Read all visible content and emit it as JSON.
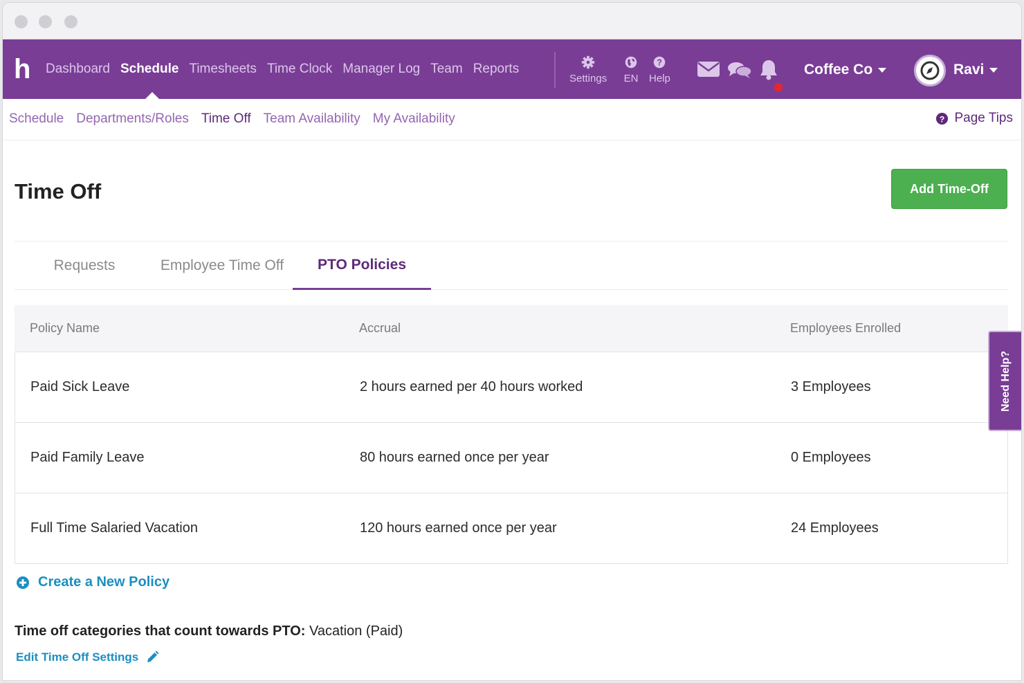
{
  "app": {
    "logo": "h",
    "nav": [
      {
        "label": "Dashboard",
        "active": false
      },
      {
        "label": "Schedule",
        "active": true
      },
      {
        "label": "Timesheets",
        "active": false
      },
      {
        "label": "Time Clock",
        "active": false
      },
      {
        "label": "Manager Log",
        "active": false
      },
      {
        "label": "Team",
        "active": false
      },
      {
        "label": "Reports",
        "active": false
      }
    ],
    "tools": {
      "settings": "Settings",
      "language": "EN",
      "help": "Help"
    },
    "icons": [
      "envelope-icon",
      "chat-bubbles-icon",
      "bell-icon"
    ],
    "company": "Coffee Co",
    "user": "Ravi"
  },
  "subnav": {
    "items": [
      {
        "label": "Schedule",
        "active": false
      },
      {
        "label": "Departments/Roles",
        "active": false
      },
      {
        "label": "Time Off",
        "active": true
      },
      {
        "label": "Team Availability",
        "active": false
      },
      {
        "label": "My Availability",
        "active": false
      }
    ],
    "page_tips": "Page Tips"
  },
  "page": {
    "title": "Time Off",
    "add_button": "Add Time-Off",
    "tabs": [
      {
        "label": "Requests",
        "active": false
      },
      {
        "label": "Employee Time Off",
        "active": false
      },
      {
        "label": "PTO Policies",
        "active": true
      }
    ]
  },
  "table": {
    "headers": [
      "Policy Name",
      "Accrual",
      "Employees Enrolled"
    ],
    "rows": [
      [
        "Paid Sick Leave",
        "2 hours earned per 40 hours worked",
        "3 Employees"
      ],
      [
        "Paid Family Leave",
        "80 hours earned once per year",
        "0 Employees"
      ],
      [
        "Full Time Salaried Vacation",
        "120 hours earned once per year",
        "24 Employees"
      ]
    ]
  },
  "footer": {
    "create_policy": "Create a New Policy",
    "pto_label": "Time off categories that count towards PTO:",
    "pto_value": "Vacation (Paid)",
    "edit_settings": "Edit Time Off Settings"
  },
  "need_help": "Need Help?",
  "colors": {
    "brand_purple": "#7a3d96",
    "accent_green": "#4caf50",
    "link_blue": "#1b8fc0",
    "notification_red": "#e8262a"
  }
}
